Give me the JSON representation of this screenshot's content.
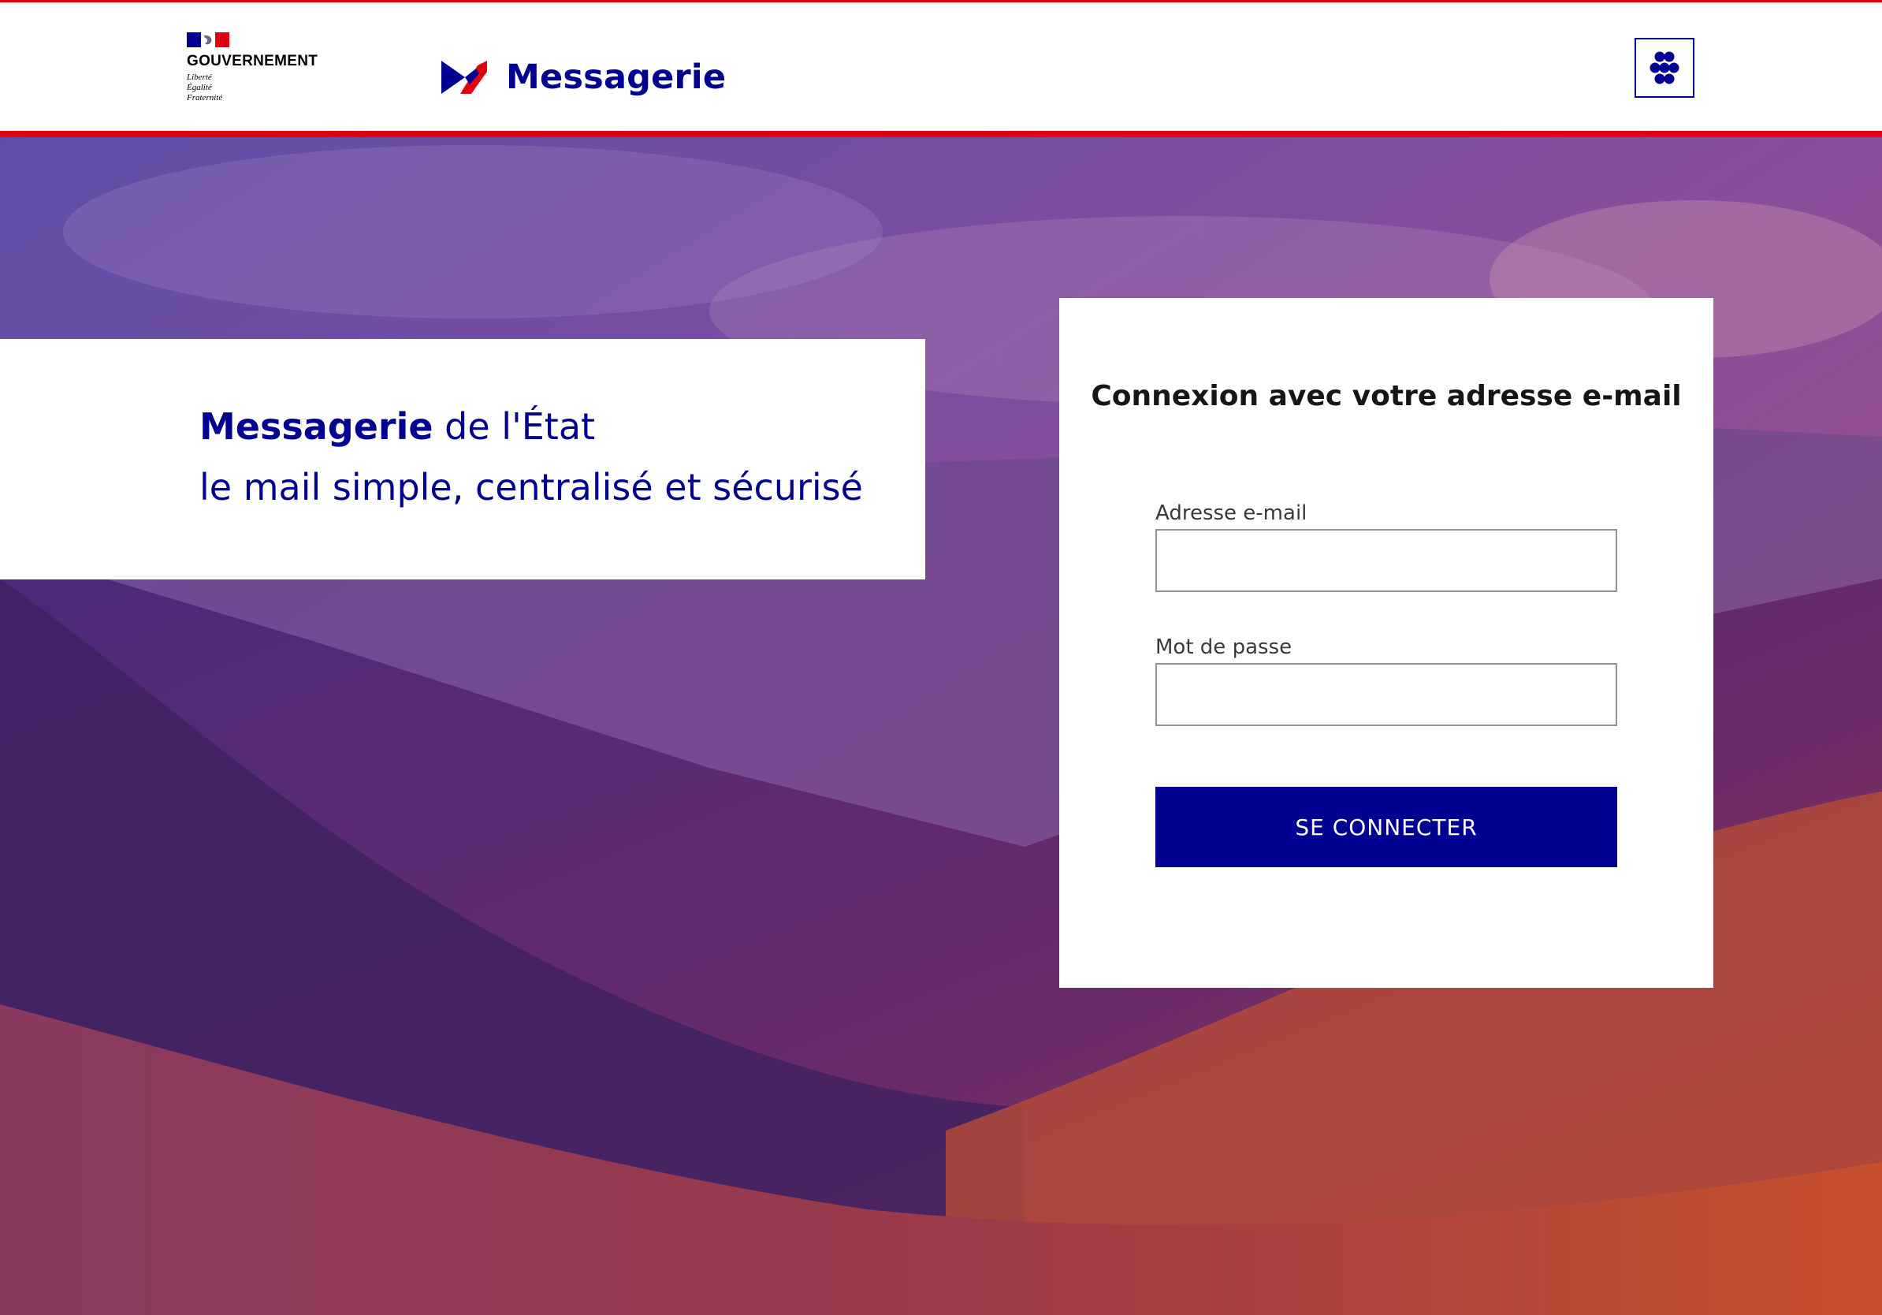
{
  "header": {
    "government": {
      "name": "GOUVERNEMENT",
      "motto": [
        "Liberté",
        "Égalité",
        "Fraternité"
      ]
    },
    "brand": {
      "name": "Messagerie",
      "logo_icon": "messagerie-logo-icon"
    },
    "apps_button": {
      "icon": "apps-grid-icon"
    }
  },
  "hero": {
    "tagline": {
      "brand_strong": "Messagerie",
      "line1_rest": " de l'État",
      "line2": "le mail simple, centralisé et sécurisé"
    }
  },
  "login": {
    "title": "Connexion avec votre adresse e-mail",
    "email_label": "Adresse e-mail",
    "email_value": "",
    "password_label": "Mot de passe",
    "password_value": "",
    "submit_label": "SE CONNECTER"
  },
  "colors": {
    "brand_blue": "#000091",
    "brand_red": "#e1000f"
  }
}
